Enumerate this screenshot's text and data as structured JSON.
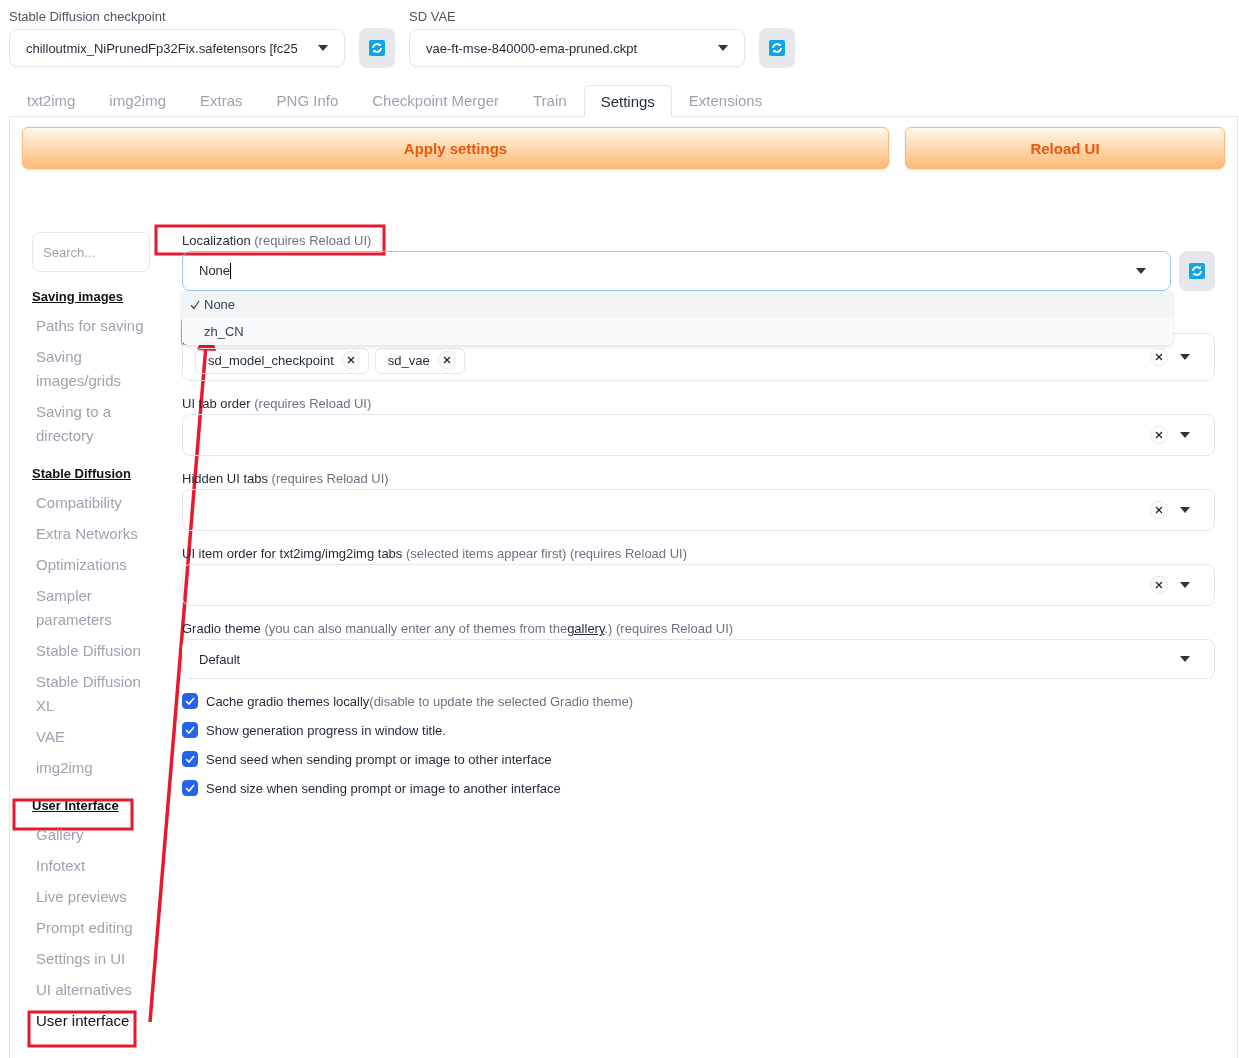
{
  "top_selects": [
    {
      "label": "Stable Diffusion checkpoint",
      "value": "chilloutmix_NiPrunedFp32Fix.safetensors [fc25"
    },
    {
      "label": "SD VAE",
      "value": "vae-ft-mse-840000-ema-pruned.ckpt"
    }
  ],
  "tabs": [
    {
      "label": "txt2img",
      "selected": false
    },
    {
      "label": "img2img",
      "selected": false
    },
    {
      "label": "Extras",
      "selected": false
    },
    {
      "label": "PNG Info",
      "selected": false
    },
    {
      "label": "Checkpoint Merger",
      "selected": false
    },
    {
      "label": "Train",
      "selected": false
    },
    {
      "label": "Settings",
      "selected": true
    },
    {
      "label": "Extensions",
      "selected": false
    }
  ],
  "buttons": [
    "Apply settings",
    "Reload UI"
  ],
  "sidebar": {
    "search": {
      "placeholder": "Search..."
    },
    "groups": [
      {
        "title": "Saving images",
        "items": [
          {
            "label": "Paths for saving",
            "selected": false
          },
          {
            "label": "Saving images/grids",
            "selected": false
          },
          {
            "label": "Saving to a directory",
            "selected": false
          }
        ]
      },
      {
        "title": "Stable Diffusion",
        "items": [
          {
            "label": "Compatibility",
            "selected": false
          },
          {
            "label": "Extra Networks",
            "selected": false
          },
          {
            "label": "Optimizations",
            "selected": false
          },
          {
            "label": "Sampler parameters",
            "selected": false
          },
          {
            "label": "Stable Diffusion",
            "selected": false
          },
          {
            "label": "Stable Diffusion XL",
            "selected": false
          },
          {
            "label": "VAE",
            "selected": false
          },
          {
            "label": "img2img",
            "selected": false
          }
        ]
      },
      {
        "title": "User Interface",
        "items": [
          {
            "label": "Gallery",
            "selected": false
          },
          {
            "label": "Infotext",
            "selected": false
          },
          {
            "label": "Live previews",
            "selected": false
          },
          {
            "label": "Prompt editing",
            "selected": false
          },
          {
            "label": "Settings in UI",
            "selected": false
          },
          {
            "label": "UI alternatives",
            "selected": false
          },
          {
            "label": "User interface",
            "selected": true
          }
        ]
      }
    ]
  },
  "settings": [
    {
      "kind": "dropdown",
      "label": "Localization",
      "note": "(requires Reload UI)",
      "value": "None",
      "refresh": true,
      "options": [
        {
          "label": "None",
          "selected": true
        },
        {
          "label": "zh_CN",
          "selected": false
        }
      ]
    },
    {
      "kind": "multiselect",
      "chips": [
        "sd_model_checkpoint",
        "sd_vae"
      ]
    },
    {
      "kind": "multiselect",
      "label": "UI tab order",
      "note": "(requires Reload UI)"
    },
    {
      "kind": "multiselect",
      "label": "Hidden UI tabs",
      "note": "(requires Reload UI)"
    },
    {
      "kind": "multiselect",
      "label": "UI item order for txt2img/img2img tabs",
      "note": "(selected items appear first) (requires Reload UI)"
    },
    {
      "kind": "dropdown",
      "label": "Gradio theme",
      "note": "(you can also manually enter any of themes from the",
      "link": "gallery",
      "note_after": ".) (requires Reload UI)",
      "value": "Default",
      "refresh": false
    },
    {
      "kind": "checkbox",
      "label": "Cache gradio themes locally",
      "note": "(disable to update the selected Gradio theme)",
      "checked": true
    },
    {
      "kind": "checkbox",
      "label": "Show generation progress in window title.",
      "checked": true
    },
    {
      "kind": "checkbox",
      "label": "Send seed when sending prompt or image to other interface",
      "checked": true
    },
    {
      "kind": "checkbox",
      "label": "Send size when sending prompt or image to another interface",
      "checked": true
    }
  ]
}
